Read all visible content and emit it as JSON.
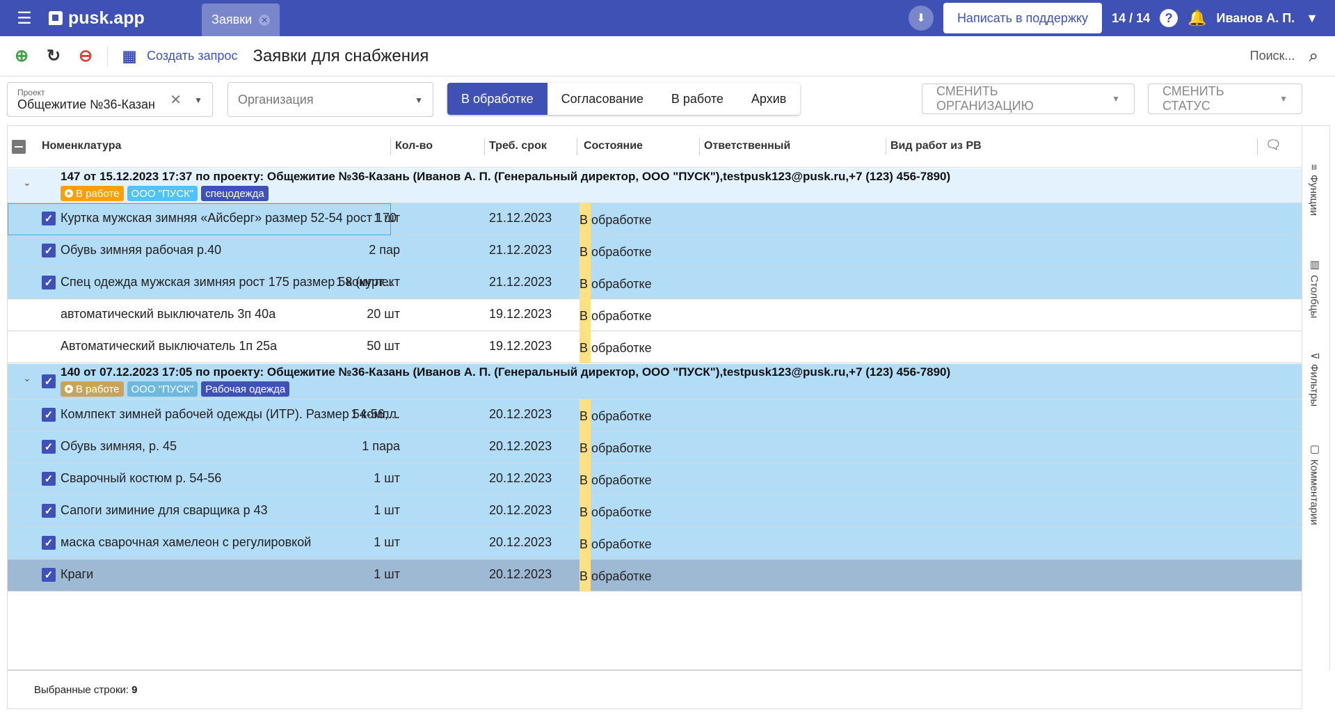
{
  "topbar": {
    "brand": "pusk.app",
    "tab_label": "Заявки",
    "support_label": "Написать в поддержку",
    "counter": "14 / 14",
    "user": "Иванов А. П."
  },
  "toolbar": {
    "create_label": "Создать запрос",
    "page_title": "Заявки для снабжения",
    "search_placeholder": "Поиск..."
  },
  "filters": {
    "project_label": "Проект",
    "project_value": "Общежитие №36-Казан",
    "org_placeholder": "Организация",
    "segments": [
      "В обработке",
      "Согласование",
      "В работе",
      "Архив"
    ],
    "active_segment": "В обработке",
    "change_org": "СМЕНИТЬ ОРГАНИЗАЦИЮ",
    "change_status": "СМЕНИТЬ СТАТУС"
  },
  "grid": {
    "columns": [
      "Номенклатура",
      "Кол-во",
      "Треб. срок",
      "Состояние",
      "Ответственный",
      "Вид работ из РВ"
    ],
    "groups": [
      {
        "title": "147 от 15.12.2023 17:37 по проекту: Общежитие №36-Казань (Иванов А. П. (Генеральный директор, ООО \"ПУСК\"),testpusk123@pusk.ru,+7 (123) 456-7890)",
        "tags": [
          "В работе",
          "ООО \"ПУСК\"",
          "спецодежда"
        ],
        "rows": [
          {
            "name": "Куртка мужская зимняя «Айсберг» размер 52-54 рост 170",
            "qty": "1 шт",
            "date": "21.12.2023",
            "state": "В обработке"
          },
          {
            "name": "Обувь зимняя рабочая р.40",
            "qty": "2 пар",
            "date": "21.12.2023",
            "state": "В обработке"
          },
          {
            "name": "Спец одежда мужская зимняя рост 175 размер 58 (курт...",
            "qty": "1 комплект",
            "date": "21.12.2023",
            "state": "В обработке"
          },
          {
            "name": "автоматический выключатель 3п 40а",
            "qty": "20 шт",
            "date": "19.12.2023",
            "state": "В обработке"
          },
          {
            "name": "Автоматический выключатель 1п 25а",
            "qty": "50 шт",
            "date": "19.12.2023",
            "state": "В обработке"
          }
        ]
      },
      {
        "title": "140 от 07.12.2023 17:05 по проекту: Общежитие №36-Казань (Иванов А. П. (Генеральный директор, ООО \"ПУСК\"),testpusk123@pusk.ru,+7 (123) 456-7890)",
        "tags": [
          "В работе",
          "ООО \"ПУСК\"",
          "Рабочая одежда"
        ],
        "rows": [
          {
            "name": "Комлпект зимней рабочей одежды (ИТР). Размер 54-56,...",
            "qty": "1 компл.",
            "date": "20.12.2023",
            "state": "В обработке"
          },
          {
            "name": "Обувь зимняя, р. 45",
            "qty": "1 пара",
            "date": "20.12.2023",
            "state": "В обработке"
          },
          {
            "name": "Сварочный костюм р. 54-56",
            "qty": "1 шт",
            "date": "20.12.2023",
            "state": "В обработке"
          },
          {
            "name": "Сапоги зиминие для сварщика р 43",
            "qty": "1 шт",
            "date": "20.12.2023",
            "state": "В обработке"
          },
          {
            "name": "маска сварочная хамелеон с регулировкой",
            "qty": "1 шт",
            "date": "20.12.2023",
            "state": "В обработке"
          },
          {
            "name": "Краги",
            "qty": "1 шт",
            "date": "20.12.2023",
            "state": "В обработке"
          }
        ]
      }
    ],
    "footer_label": "Выбранные строки:",
    "footer_count": "9"
  },
  "side_tabs": [
    "Функции",
    "Столбцы",
    "Фильтры",
    "Комментарии"
  ]
}
